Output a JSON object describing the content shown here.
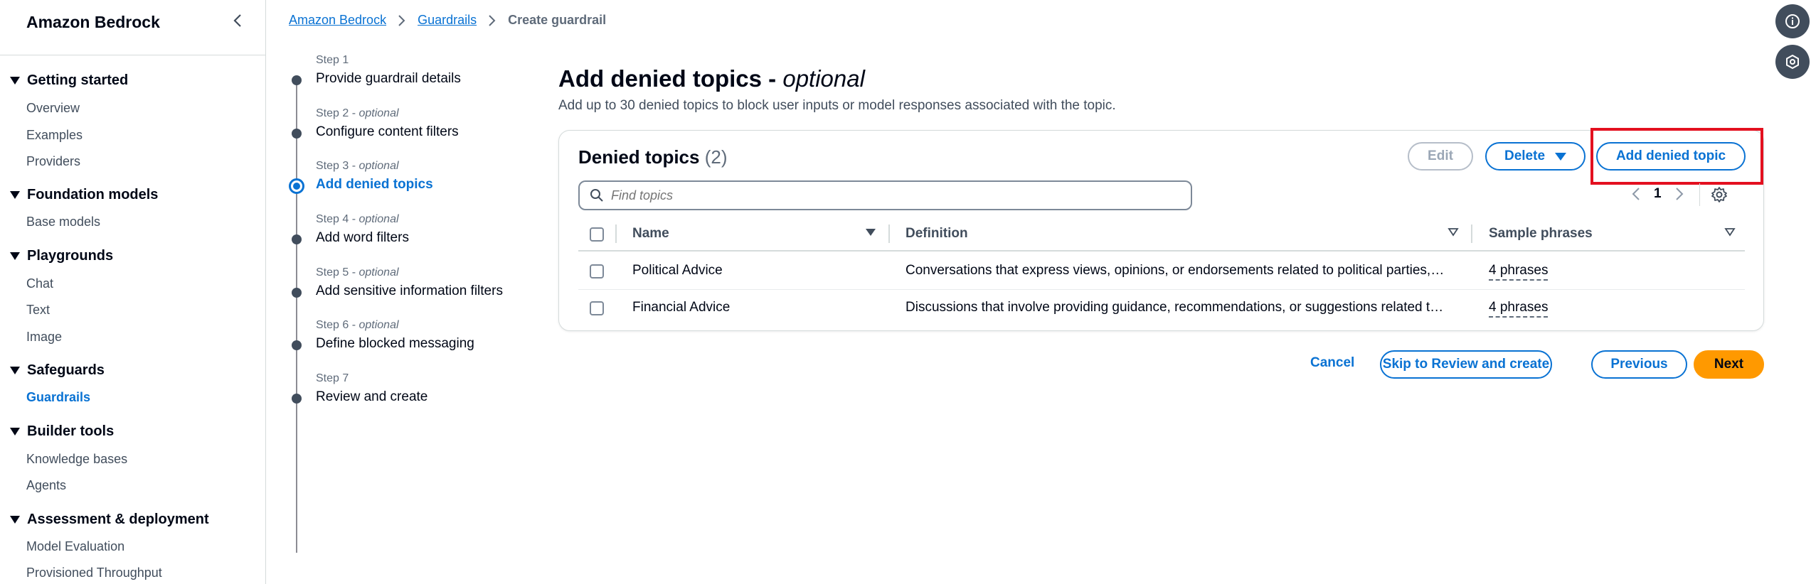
{
  "sidebar": {
    "title": "Amazon Bedrock",
    "groups": [
      {
        "label": "Getting started",
        "items": [
          "Overview",
          "Examples",
          "Providers"
        ]
      },
      {
        "label": "Foundation models",
        "items": [
          "Base models"
        ]
      },
      {
        "label": "Playgrounds",
        "items": [
          "Chat",
          "Text",
          "Image"
        ]
      },
      {
        "label": "Safeguards",
        "items": [
          "Guardrails"
        ]
      },
      {
        "label": "Builder tools",
        "items": [
          "Knowledge bases",
          "Agents"
        ]
      },
      {
        "label": "Assessment & deployment",
        "items": [
          "Model Evaluation",
          "Provisioned Throughput"
        ]
      }
    ],
    "active_item": "Guardrails"
  },
  "breadcrumb": {
    "items": [
      "Amazon Bedrock",
      "Guardrails"
    ],
    "current": "Create guardrail"
  },
  "steps": [
    {
      "label": "Step 1",
      "optional": "",
      "name": "Provide guardrail details"
    },
    {
      "label": "Step 2 - ",
      "optional": "optional",
      "name": "Configure content filters"
    },
    {
      "label": "Step 3 - ",
      "optional": "optional",
      "name": "Add denied topics"
    },
    {
      "label": "Step 4 - ",
      "optional": "optional",
      "name": "Add word filters"
    },
    {
      "label": "Step 5 - ",
      "optional": "optional",
      "name": "Add sensitive information filters"
    },
    {
      "label": "Step 6 - ",
      "optional": "optional",
      "name": "Define blocked messaging"
    },
    {
      "label": "Step 7",
      "optional": "",
      "name": "Review and create"
    }
  ],
  "page": {
    "title": "Add denied topics - ",
    "title_optional": "optional",
    "description": "Add up to 30 denied topics to block user inputs or model responses associated with the topic."
  },
  "denied_topics": {
    "title": "Denied topics",
    "count": "(2)",
    "edit_label": "Edit",
    "delete_label": "Delete",
    "add_label": "Add denied topic",
    "search_placeholder": "Find topics",
    "page_number": "1",
    "columns": [
      "Name",
      "Definition",
      "Sample phrases"
    ],
    "rows": [
      {
        "name": "Political Advice",
        "definition": "Conversations that express views, opinions, or endorsements related to political parties, …",
        "phrases": "4 phrases"
      },
      {
        "name": "Financial Advice",
        "definition": "Discussions that involve providing guidance, recommendations, or suggestions related t…",
        "phrases": "4 phrases"
      }
    ]
  },
  "footer": {
    "cancel": "Cancel",
    "skip": "Skip to Review and create",
    "previous": "Previous",
    "next": "Next"
  },
  "icons": [
    "chevron-left-icon",
    "info-icon",
    "settings-circle-icon",
    "search-icon",
    "gear-icon"
  ],
  "colors": {
    "link": "#0972d3",
    "primary": "#ff9900",
    "highlight": "#e3101f",
    "text": "#000716"
  }
}
